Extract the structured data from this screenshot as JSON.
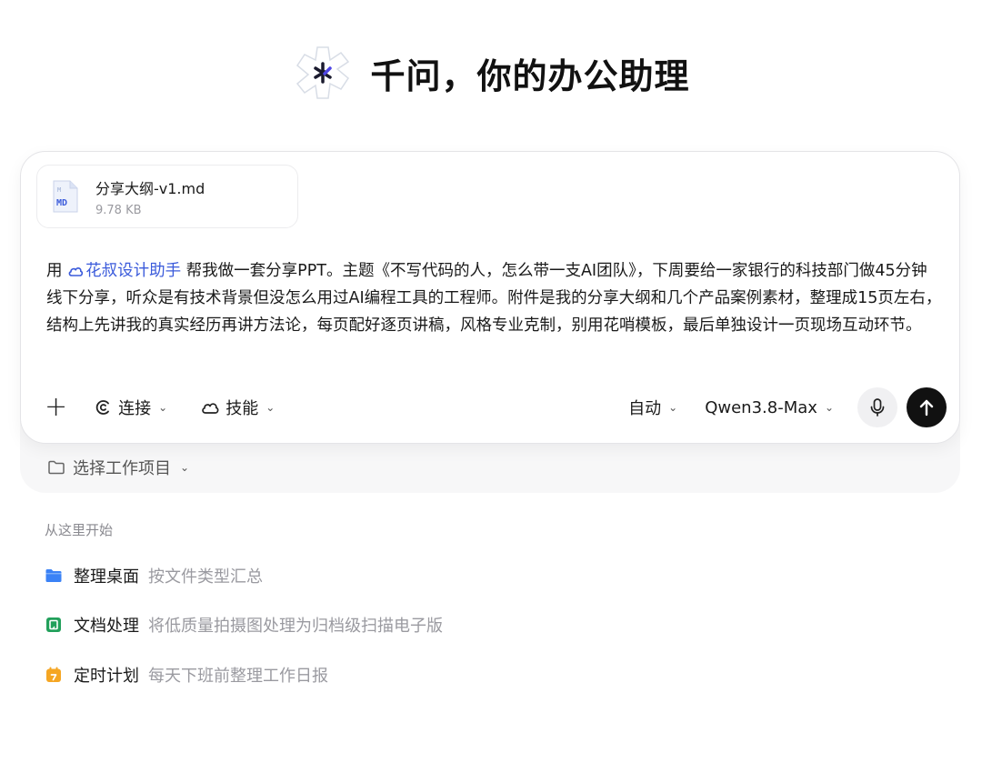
{
  "hero": {
    "title": "千问，你的办公助理"
  },
  "attachment": {
    "name": "分享大纲-v1.md",
    "size": "9.78 KB",
    "type_label": "MD",
    "type_letter": "M"
  },
  "prompt": {
    "prefix": "用",
    "skill": "花叔设计助手",
    "text": "帮我做一套分享PPT。主题《不写代码的人，怎么带一支AI团队》，下周要给一家银行的科技部门做45分钟线下分享，听众是有技术背景但没怎么用过AI编程工具的工程师。附件是我的分享大纲和几个产品案例素材，整理成15页左右，结构上先讲我的真实经历再讲方法论，每页配好逐页讲稿，风格专业克制，别用花哨模板，最后单独设计一页现场互动环节。"
  },
  "toolbar": {
    "connect_label": "连接",
    "skills_label": "技能",
    "mode_label": "自动",
    "model_label": "Qwen3.8-Max"
  },
  "project": {
    "label": "选择工作项目"
  },
  "start": {
    "label": "从这里开始",
    "items": [
      {
        "title": "整理桌面",
        "desc": "按文件类型汇总",
        "icon": "folder-icon",
        "color": "#3b82f6"
      },
      {
        "title": "文档处理",
        "desc": "将低质量拍摄图处理为归档级扫描电子版",
        "icon": "document-icon",
        "color": "#22a05b"
      },
      {
        "title": "定时计划",
        "desc": "每天下班前整理工作日报",
        "icon": "calendar-icon",
        "color": "#f5a623"
      }
    ]
  }
}
